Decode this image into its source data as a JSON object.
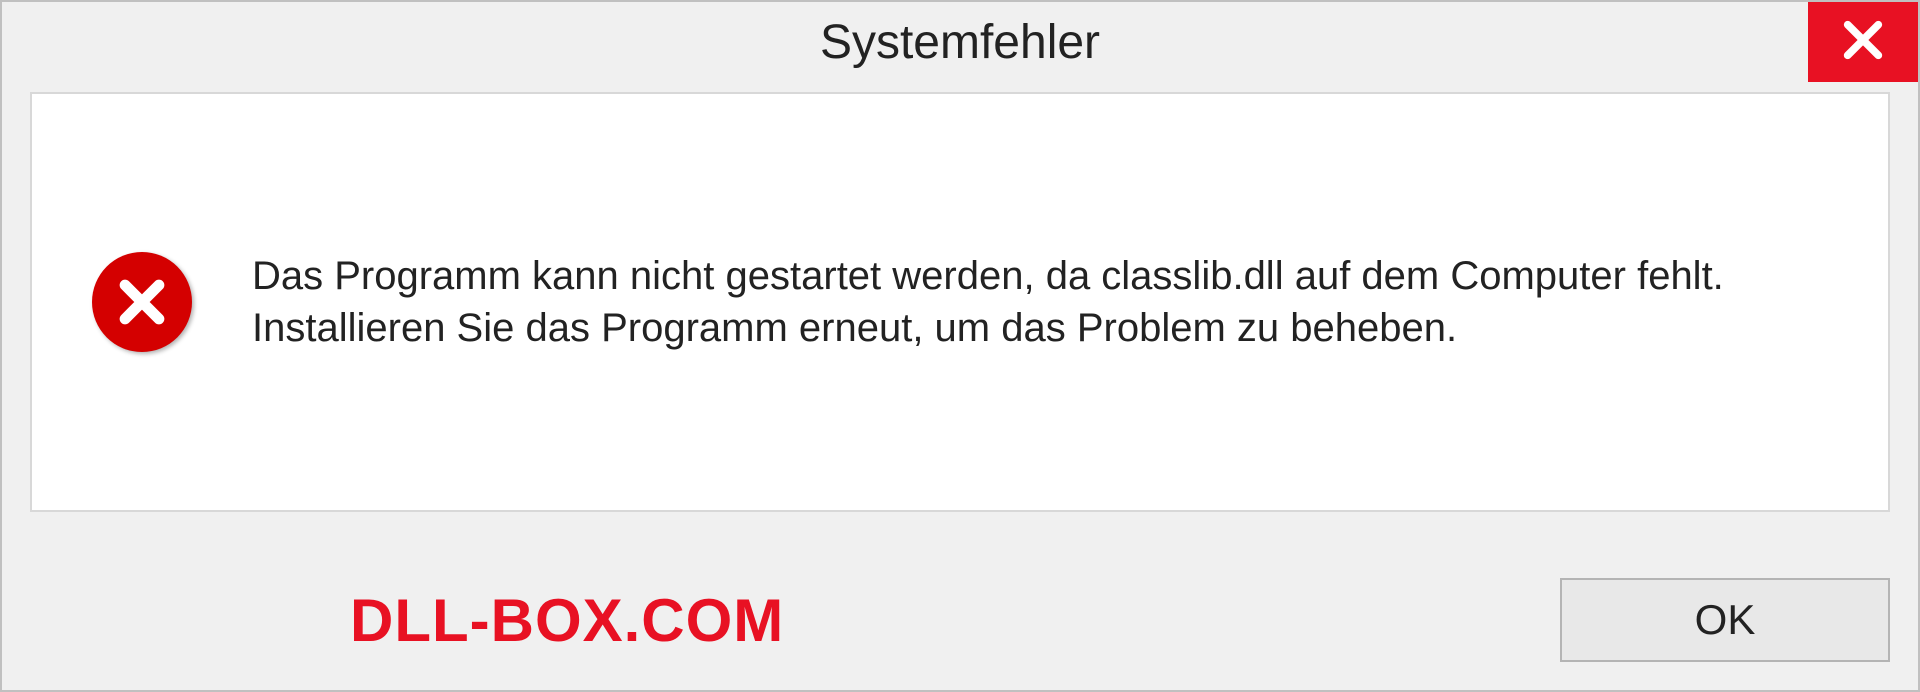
{
  "dialog": {
    "title": "Systemfehler",
    "message": "Das Programm kann nicht gestartet werden, da classlib.dll auf dem Computer fehlt. Installieren Sie das Programm erneut, um das Problem zu beheben.",
    "ok_label": "OK"
  },
  "watermark": "DLL-BOX.COM",
  "colors": {
    "close_bg": "#e81123",
    "error_circle": "#d40000",
    "watermark": "#e81123"
  }
}
